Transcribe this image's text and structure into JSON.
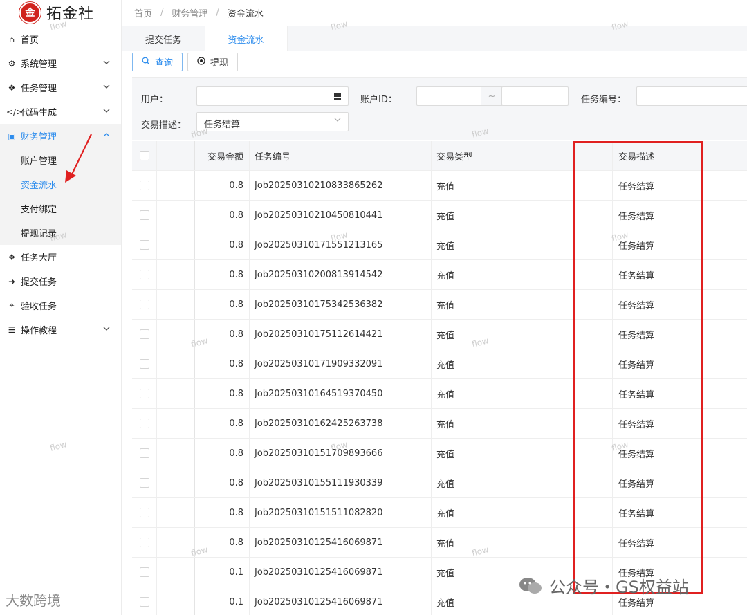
{
  "app": {
    "logo_mark": "金",
    "logo_text": "拓金社"
  },
  "sidebar": {
    "items": [
      {
        "icon": "home-icon",
        "glyph": "⌂",
        "label": "首页",
        "has_chevron": false
      },
      {
        "icon": "cogs-icon",
        "glyph": "⚙",
        "label": "系统管理",
        "has_chevron": true
      },
      {
        "icon": "cubes-icon",
        "glyph": "❖",
        "label": "任务管理",
        "has_chevron": true
      },
      {
        "icon": "code-icon",
        "glyph": "</>",
        "label": "代码生成",
        "has_chevron": true
      },
      {
        "icon": "money-icon",
        "glyph": "▣",
        "label": "财务管理",
        "has_chevron": true
      }
    ],
    "finance_children": [
      "账户管理",
      "资金流水",
      "支付绑定",
      "提现记录"
    ],
    "items_after": [
      {
        "icon": "cubes-icon",
        "glyph": "❖",
        "label": "任务大厅",
        "has_chevron": false
      },
      {
        "icon": "arrow-right-icon",
        "glyph": "➜",
        "label": "提交任务",
        "has_chevron": false
      },
      {
        "icon": "telescope-icon",
        "glyph": "⌖",
        "label": "验收任务",
        "has_chevron": false
      },
      {
        "icon": "list-icon",
        "glyph": "☰",
        "label": "操作教程",
        "has_chevron": true
      }
    ]
  },
  "breadcrumb": [
    "首页",
    "财务管理",
    "资金流水"
  ],
  "tabs": [
    "提交任务",
    "资金流水"
  ],
  "toolbar": {
    "query": "查询",
    "withdraw": "提现"
  },
  "filters": {
    "user_label": "用户：",
    "account_label": "账户ID：",
    "range_sep": "~",
    "job_label": "任务编号：",
    "desc_label": "交易描述：",
    "desc_value": "任务结算"
  },
  "table": {
    "headers": [
      "交易金额",
      "任务编号",
      "交易类型",
      "交易描述"
    ],
    "rows": [
      [
        "0.8",
        "Job20250310210833865262",
        "充值",
        "任务结算"
      ],
      [
        "0.8",
        "Job20250310210450810441",
        "充值",
        "任务结算"
      ],
      [
        "0.8",
        "Job20250310171551213165",
        "充值",
        "任务结算"
      ],
      [
        "0.8",
        "Job20250310200813914542",
        "充值",
        "任务结算"
      ],
      [
        "0.8",
        "Job20250310175342536382",
        "充值",
        "任务结算"
      ],
      [
        "0.8",
        "Job20250310175112614421",
        "充值",
        "任务结算"
      ],
      [
        "0.8",
        "Job20250310171909332091",
        "充值",
        "任务结算"
      ],
      [
        "0.8",
        "Job20250310164519370450",
        "充值",
        "任务结算"
      ],
      [
        "0.8",
        "Job20250310162425263738",
        "充值",
        "任务结算"
      ],
      [
        "0.8",
        "Job20250310151709893666",
        "充值",
        "任务结算"
      ],
      [
        "0.8",
        "Job20250310155111930339",
        "充值",
        "任务结算"
      ],
      [
        "0.8",
        "Job20250310151511082820",
        "充值",
        "任务结算"
      ],
      [
        "0.8",
        "Job20250310125416069871",
        "充值",
        "任务结算"
      ],
      [
        "0.1",
        "Job20250310125416069871",
        "充值",
        "任务结算"
      ],
      [
        "0.1",
        "Job20250310125416069871",
        "充值",
        "任务结算"
      ]
    ]
  },
  "watermark": "flow",
  "overlay": {
    "wechat_text": "公众号・GS权益站",
    "brand_text": "大数跨境"
  },
  "colors": {
    "accent": "#2e8ded",
    "annotation": "#e02020",
    "logo": "#d0231d"
  }
}
